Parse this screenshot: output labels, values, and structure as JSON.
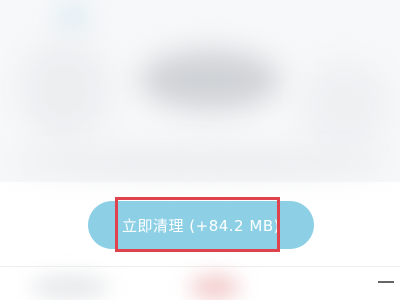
{
  "clean_button": {
    "label": "立即清理 (+84.2 MB)"
  },
  "colors": {
    "button_bg": "#8dd0e5",
    "highlight": "#e0424d"
  }
}
